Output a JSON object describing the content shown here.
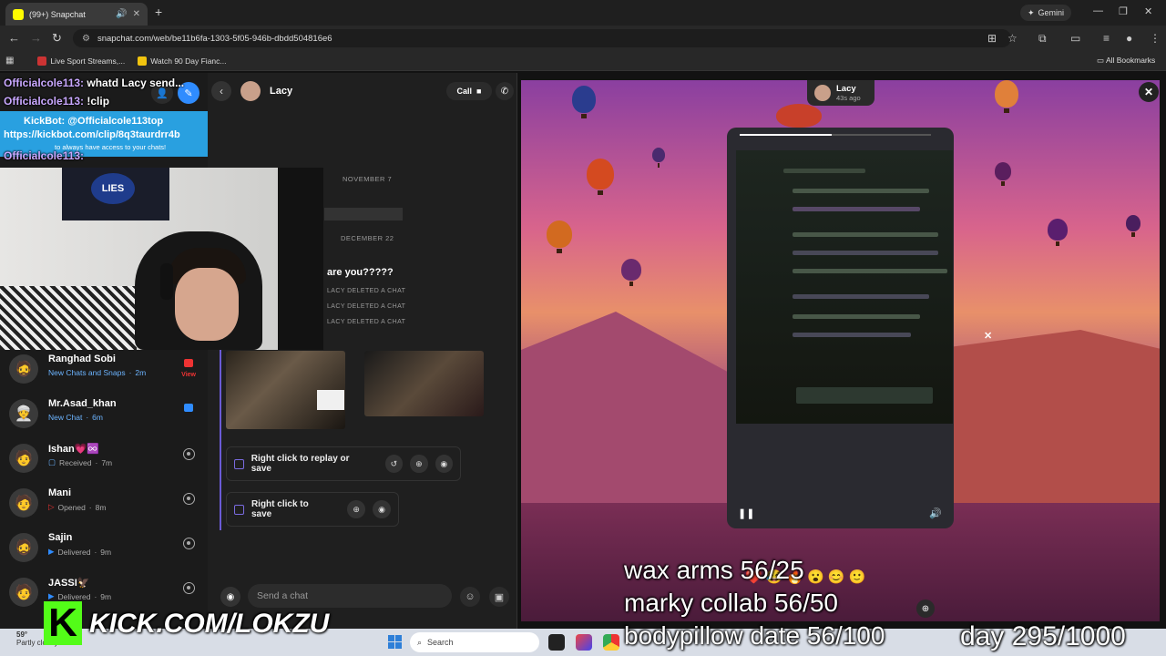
{
  "browser": {
    "tab_title": "(99+) Snapchat",
    "url": "snapchat.com/web/be11b6fa-1303-5f05-946b-dbdd504816e6",
    "gemini_label": "Gemini",
    "bookmarks": [
      "Live Sport Streams,...",
      "Watch 90 Day Fianc..."
    ],
    "all_bookmarks": "All Bookmarks"
  },
  "sidebar": {
    "chats": [
      {
        "name": "Ranghad Sobi",
        "status": "New Chats and Snaps",
        "time": "2m",
        "badge": "View"
      },
      {
        "name": "Mr.Asad_khan",
        "status": "New Chat",
        "time": "6m"
      },
      {
        "name": "Ishan💗♾️",
        "status": "Received",
        "time": "7m"
      },
      {
        "name": "Mani",
        "status": "Opened",
        "time": "8m"
      },
      {
        "name": "Sajin",
        "status": "Delivered",
        "time": "9m"
      },
      {
        "name": "JASSI🦅",
        "status": "Delivered",
        "time": "9m"
      }
    ]
  },
  "chat": {
    "name": "Lacy",
    "call_label": "Call",
    "dates": [
      "NOVEMBER 7",
      "DECEMBER 22"
    ],
    "message": "are you?????",
    "deleted_notes": [
      "LACY DELETED A CHAT",
      "LACY DELETED A CHAT",
      "LACY DELETED A CHAT"
    ],
    "replay_label": "Right click to replay or save",
    "save_label": "Right click to save",
    "composer_placeholder": "Send a chat"
  },
  "viewer": {
    "sender": "Lacy",
    "time_ago": "43s ago",
    "story_progress": 0.48
  },
  "overlay": {
    "chat_lines": [
      {
        "user": "Officialcole113:",
        "text": "whatd Lacy send..."
      },
      {
        "user": "Officialcole113:",
        "text": "!clip"
      },
      {
        "user": "Officialcole113:",
        "text": ""
      }
    ],
    "kickbot_line1": "KickBot: @Officialcole113top",
    "kickbot_line2": "https://kickbot.com/clip/8q3taurdrr4b",
    "kickbot_line3": "to always have access to your chats!",
    "poster_text": "LIES",
    "stats": [
      "wax arms 56/25",
      "marky collab 56/50",
      "bodypillow date 56/100"
    ],
    "day_counter": "day 295/1000",
    "kick_url": "KICK.COM/LOKZU"
  },
  "taskbar": {
    "weather": "59°",
    "weather_sub": "Partly cloudy",
    "search": "Search"
  },
  "colors": {
    "snap_yellow": "#fffc00",
    "kick_green": "#53fc18",
    "accent_purple": "#6b5bd6",
    "kickbot_blue": "#29a0e0"
  }
}
